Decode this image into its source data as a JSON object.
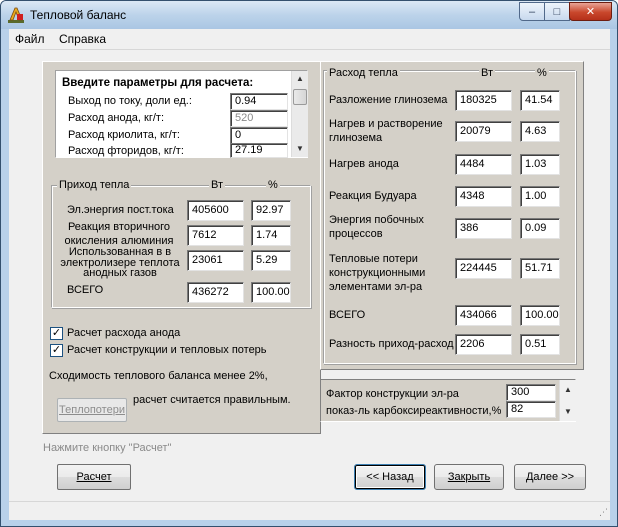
{
  "window": {
    "title": "Тепловой баланс",
    "controls": {
      "minimize": "–",
      "maximize": "□",
      "close": "✕"
    }
  },
  "menu": [
    {
      "label": "Файл"
    },
    {
      "label": "Справка"
    }
  ],
  "params": {
    "header": "Введите параметры для расчета:",
    "rows": [
      {
        "label": "Выход по току, доли ед.:",
        "value": "0.94",
        "enabled": true
      },
      {
        "label": "Расход анода, кг/т:",
        "value": "520",
        "enabled": false
      },
      {
        "label": "Расход криолита, кг/т:",
        "value": "0",
        "enabled": true
      },
      {
        "label": "Расход фторидов, кг/т:",
        "value": "27.19",
        "enabled": true
      }
    ]
  },
  "income": {
    "title": "Приход тепла",
    "col_w": "Вт",
    "col_pct": "%",
    "rows": [
      {
        "label": "Эл.энергия пост.тока",
        "w": "405600",
        "pct": "92.97"
      },
      {
        "label": "Реакция вторичного окисления алюминия",
        "w": "7612",
        "pct": "1.74"
      },
      {
        "label": "Использованная в в электролизере теплота анодных газов",
        "w": "23061",
        "pct": "5.29"
      },
      {
        "label": "ВСЕГО",
        "w": "436272",
        "pct": "100.00"
      }
    ]
  },
  "options": {
    "anode_calc": {
      "label": "Расчет расхода анода",
      "checked": true
    },
    "construction_calc": {
      "label": "Расчет конструкции и тепловых потерь",
      "checked": true
    }
  },
  "convergence": {
    "line1": "Сходимость теплового баланса менее 2%,",
    "line2": "расчет считается правильным."
  },
  "heatloss_button": "Теплопотери",
  "expense": {
    "title": "Расход тепла",
    "col_w": "Вт",
    "col_pct": "%",
    "rows": [
      {
        "label": "Разложение глинозема",
        "w": "180325",
        "pct": "41.54"
      },
      {
        "label": "Нагрев и растворение глинозема",
        "w": "20079",
        "pct": "4.63"
      },
      {
        "label": "Нагрев анода",
        "w": "4484",
        "pct": "1.03"
      },
      {
        "label": "Реакция Будуара",
        "w": "4348",
        "pct": "1.00"
      },
      {
        "label": "Энергия побочных процессов",
        "w": "386",
        "pct": "0.09"
      },
      {
        "label": "Тепловые потери конструкционными элементами эл-ра",
        "w": "224445",
        "pct": "51.71"
      },
      {
        "label": "ВСЕГО",
        "w": "434066",
        "pct": "100.00"
      }
    ],
    "diff_label": "Разность приход-расход",
    "diff_w": "2206",
    "diff_pct": "0.51"
  },
  "factors": {
    "rows": [
      {
        "label": "Фактор конструкции эл-ра",
        "value": "300"
      },
      {
        "label": "показ-ль карбоксиреактивности,%",
        "value": "82"
      }
    ]
  },
  "hint": "Нажмите кнопку \"Расчет\"",
  "buttons": {
    "calc": "Расчет",
    "back": "<< Назад",
    "close": "Закрыть",
    "next": "Далее >>"
  }
}
